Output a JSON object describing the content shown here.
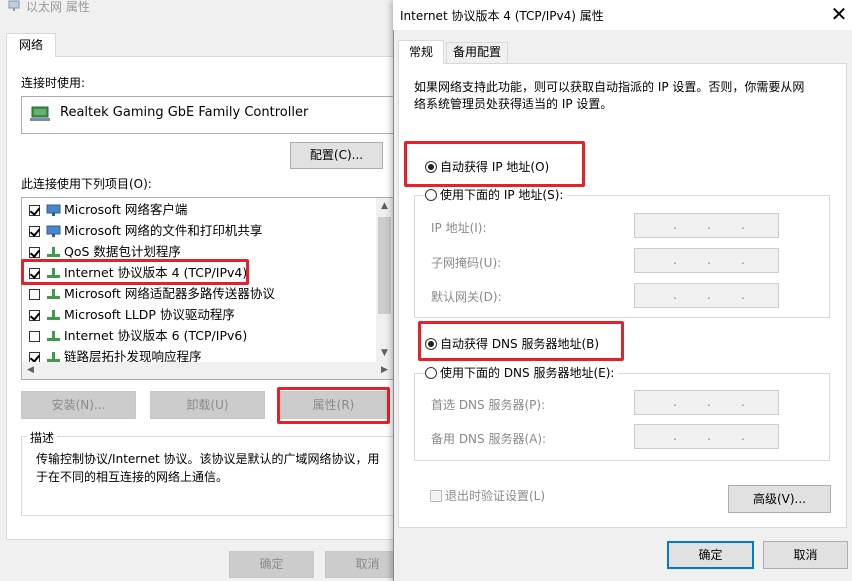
{
  "ethernet_dialog": {
    "title": "以太网 属性",
    "tab": "网络",
    "connect_using_label": "连接时使用:",
    "adapter_name": "Realtek Gaming GbE Family Controller",
    "configure_button": "配置(C)...",
    "items_label": "此连接使用下列项目(O):",
    "items": [
      {
        "label": "Microsoft 网络客户端",
        "checked": true,
        "icon": "network-client-icon"
      },
      {
        "label": "Microsoft 网络的文件和打印机共享",
        "checked": true,
        "icon": "file-sharing-icon"
      },
      {
        "label": "QoS 数据包计划程序",
        "checked": true,
        "icon": "protocol-icon"
      },
      {
        "label": "Internet 协议版本 4 (TCP/IPv4)",
        "checked": true,
        "icon": "protocol-icon"
      },
      {
        "label": "Microsoft 网络适配器多路传送器协议",
        "checked": false,
        "icon": "protocol-icon"
      },
      {
        "label": "Microsoft LLDP 协议驱动程序",
        "checked": true,
        "icon": "protocol-icon"
      },
      {
        "label": "Internet 协议版本 6 (TCP/IPv6)",
        "checked": false,
        "icon": "protocol-icon"
      },
      {
        "label": "链路层拓扑发现响应程序",
        "checked": true,
        "icon": "protocol-icon"
      }
    ],
    "install_button": "安装(N)...",
    "uninstall_button": "卸载(U)",
    "properties_button": "属性(R)",
    "description_title": "描述",
    "description_text": "传输控制协议/Internet 协议。该协议是默认的广域网络协议，用于在不同的相互连接的网络上通信。",
    "ok_button": "确定",
    "cancel_button": "取消"
  },
  "ipv4_dialog": {
    "title": "Internet 协议版本 4 (TCP/IPv4) 属性",
    "tabs": [
      "常规",
      "备用配置"
    ],
    "intro_text": "如果网络支持此功能，则可以获取自动指派的 IP 设置。否则，你需要从网络系统管理员处获得适当的 IP 设置。",
    "auto_ip_label": "自动获得 IP 地址(O)",
    "auto_ip_selected": true,
    "manual_ip_label": "使用下面的 IP 地址(S):",
    "ip_address_label": "IP 地址(I):",
    "subnet_label": "子网掩码(U):",
    "gateway_label": "默认网关(D):",
    "auto_dns_label": "自动获得 DNS 服务器地址(B)",
    "auto_dns_selected": true,
    "manual_dns_label": "使用下面的 DNS 服务器地址(E):",
    "preferred_dns_label": "首选 DNS 服务器(P):",
    "alternate_dns_label": "备用 DNS 服务器(A):",
    "ip_dot": ".",
    "validate_label": "退出时验证设置(L)",
    "advanced_button": "高级(V)...",
    "ok_button": "确定",
    "cancel_button": "取消"
  },
  "colors": {
    "highlight_border": "#e8202a",
    "dialog_bg": "#f0f0f0",
    "default_button_border": "#0078d7"
  }
}
